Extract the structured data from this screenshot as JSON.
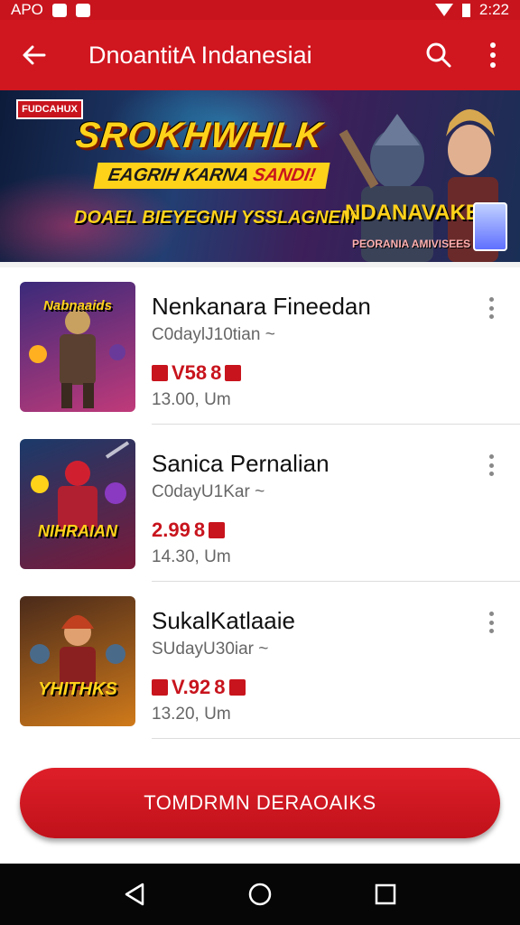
{
  "status_bar": {
    "left_text": "APO",
    "time": "2:22"
  },
  "app_bar": {
    "title": "DnoantitA Indanesiai"
  },
  "banner": {
    "logo_text": "FUDCAHUX",
    "headline": "SROKHWHLK",
    "subheadline_dark": "EAGRIH KARNA",
    "subheadline_red": "SANDI!",
    "tagline": "DOAEL BIEYEGNH YSSLAGNEM",
    "brand_top": "NDANAVAKES",
    "brand_bottom": "PEORANIA AMIVISEES"
  },
  "items": [
    {
      "thumb_label": "Nabnaaids",
      "title": "Nenkanara Fineedan",
      "meta": "C0daylJ10tian",
      "price": "V58",
      "price_suffix": "8",
      "time": "13.00, Um",
      "thumb_colors": [
        "#3a2a7a",
        "#c03a7a"
      ]
    },
    {
      "thumb_label": "NIHRAIAN",
      "title": "Sanica Pernalian",
      "meta": "C0dayU1Kar",
      "price": "2.99",
      "price_suffix": "8",
      "time": "14.30, Um",
      "thumb_colors": [
        "#1a3a6a",
        "#7a1a3a"
      ]
    },
    {
      "thumb_label": "YHITHKS",
      "title": "SukalKatlaaie",
      "meta": "SUdayU30iar",
      "price": "V.92",
      "price_suffix": "8",
      "time": "13.20, Um",
      "thumb_colors": [
        "#4a2a1a",
        "#d07a1a"
      ]
    }
  ],
  "cta": {
    "label": "TOMDRMN DERAOAIKS"
  },
  "colors": {
    "primary": "#d0161f",
    "accent": "#ffd21a"
  }
}
